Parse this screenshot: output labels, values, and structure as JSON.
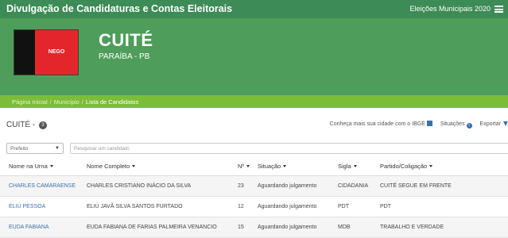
{
  "topbar": {
    "title": "Divulgação de Candidaturas e Contas Eleitorais",
    "election": "Eleições Municipais 2020"
  },
  "hero": {
    "flag_text": "NEGO",
    "city": "CUITÉ",
    "state": "PARAÍBA - PB",
    "flag_colors": {
      "left": "#111111",
      "right": "#e4262c"
    }
  },
  "breadcrumb": {
    "items": [
      "Página Inicial",
      "Município",
      "Lista de Candidatos"
    ],
    "separator": "/"
  },
  "section": {
    "title": "CUITÉ -",
    "count": "3",
    "actions": {
      "ibge": "Conheça mais sua cidade com o IBGE",
      "situacoes": "Situações",
      "exportar": "Exportar"
    }
  },
  "filters": {
    "cargo_selected": "Prefeito",
    "search_placeholder": "Pesquisar um candidato"
  },
  "table": {
    "headers": [
      "Nome na Urna",
      "Nome Completo",
      "Nº",
      "Situação",
      "Sigla",
      "Partido/Coligação"
    ],
    "rows": [
      {
        "urna": "CHARLES CAMARAENSE",
        "nome": "CHARLES CRISTIANO INÁCIO DA SILVA",
        "numero": "23",
        "situacao": "Aguardando julgamento",
        "sigla": "CIDADANIA",
        "partido": "CUITÉ SEGUE EM FRENTE"
      },
      {
        "urna": "ELIÚ PESSOA",
        "nome": "ELIÚ JAVÃ SILVA SANTOS FURTADO",
        "numero": "12",
        "situacao": "Aguardando julgamento",
        "sigla": "PDT",
        "partido": "PDT"
      },
      {
        "urna": "EUDA FABIANA",
        "nome": "EUDA FABIANA DE FARIAS PALMEIRA VENANCIO",
        "numero": "15",
        "situacao": "Aguardando julgamento",
        "sigla": "MDB",
        "partido": "TRABALHO E VERDADE"
      }
    ]
  },
  "colors": {
    "topbar": "#3d8b56",
    "hero": "#4e9d5a",
    "breadcrumb": "#7cbd38",
    "link": "#3a6fb0"
  }
}
